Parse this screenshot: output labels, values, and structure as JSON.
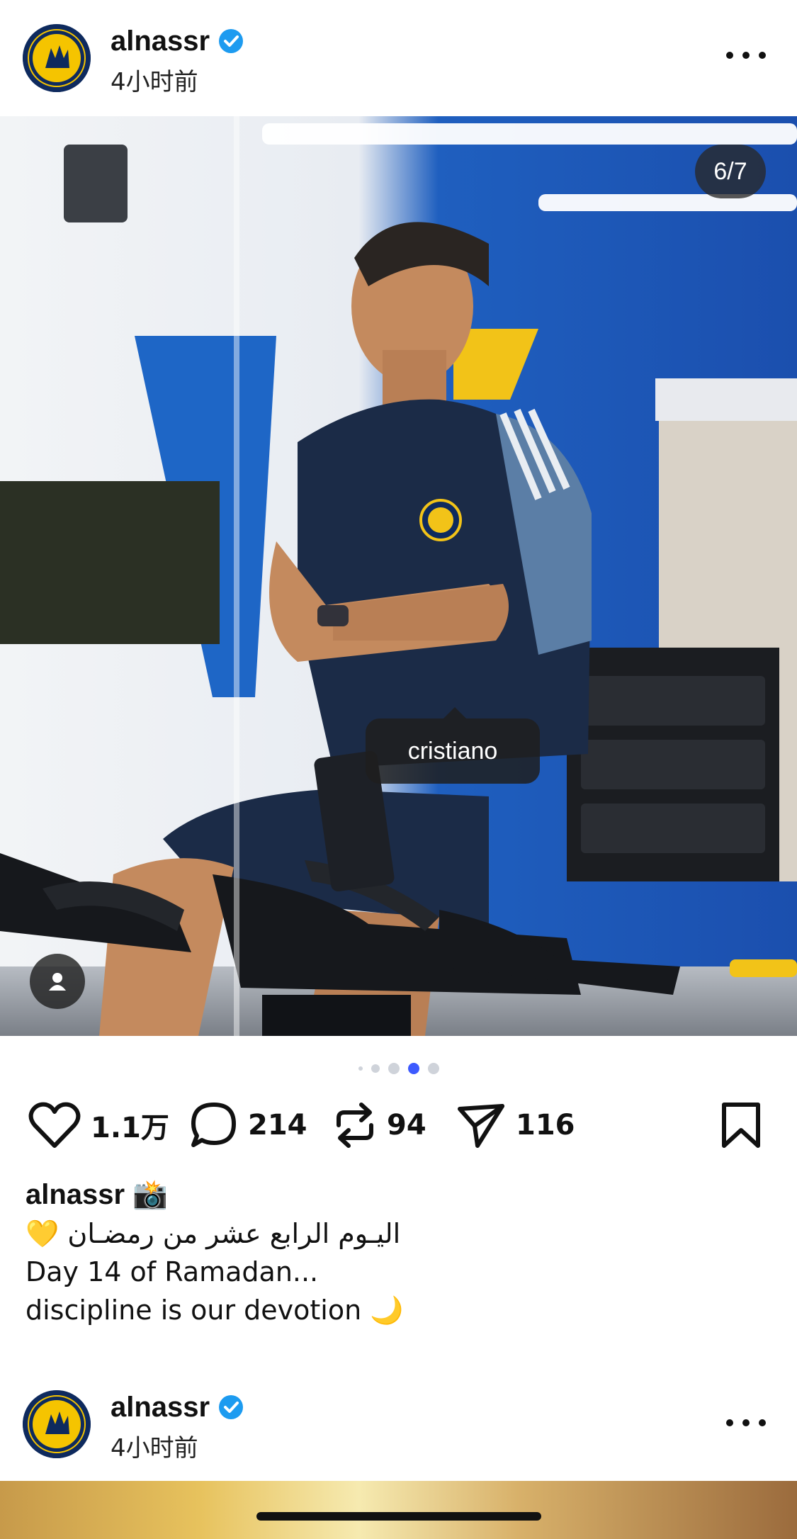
{
  "post": {
    "username": "alnassr",
    "time": "4小时前",
    "media_counter": "6/7",
    "tag_label": "cristiano",
    "carousel": {
      "total_dots_visible": 5,
      "active_index": 3
    },
    "actions": {
      "likes": "1.1万",
      "comments": "214",
      "reposts": "94",
      "shares": "116"
    },
    "caption": {
      "user_line": "alnassr 📸",
      "line1": "💛 اليـوم الرابع عشر من رمضـان",
      "line2": "Day 14 of Ramadan...",
      "line3": "discipline is our devotion 🌙"
    }
  },
  "post2": {
    "username": "alnassr",
    "time": "4小时前"
  },
  "colors": {
    "verified": "#1d9bf0",
    "carousel_active": "#3d5afe",
    "club_navy": "#0e2a5e",
    "club_yellow": "#f5c400"
  },
  "icons": {
    "like": "heart-icon",
    "comment": "comment-bubble-icon",
    "repost": "repost-icon",
    "share": "paper-plane-icon",
    "save": "bookmark-icon",
    "tags": "person-icon"
  }
}
